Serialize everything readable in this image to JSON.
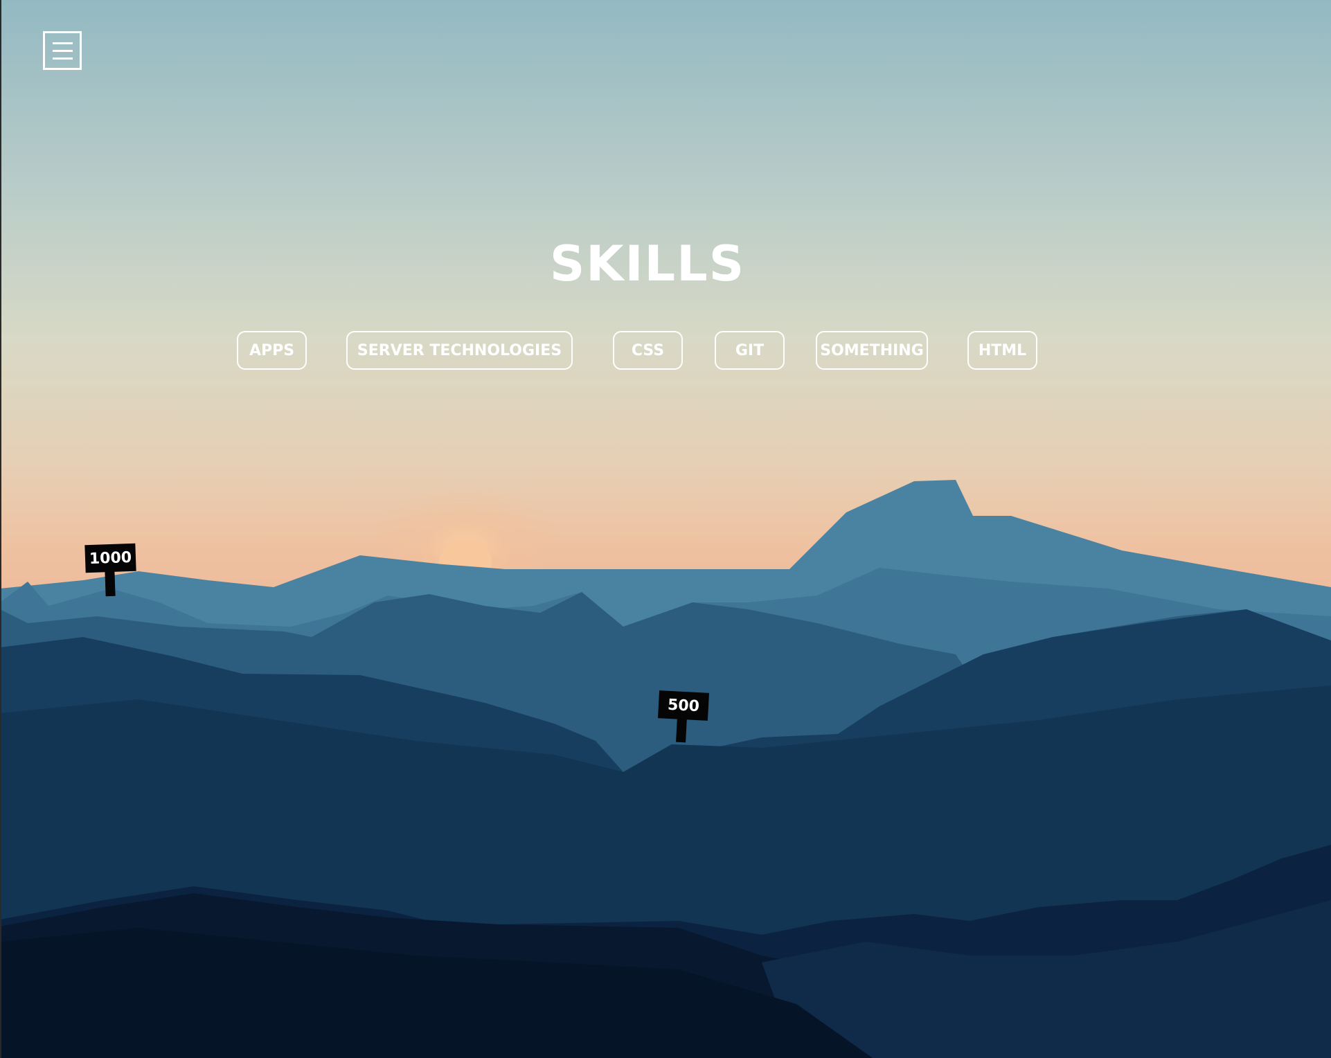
{
  "menu": {
    "icon": "hamburger-menu-icon"
  },
  "page": {
    "title": "SKILLS"
  },
  "tags": [
    {
      "label": "APPS"
    },
    {
      "label": "SERVER TECHNOLOGIES"
    },
    {
      "label": "CSS"
    },
    {
      "label": "GIT"
    },
    {
      "label": "SOMETHING"
    },
    {
      "label": "HTML"
    }
  ],
  "signs": [
    {
      "label": "1000"
    },
    {
      "label": "500"
    }
  ],
  "colors": {
    "sky_top": "#93b9c2",
    "sky_horizon": "#edc3a3",
    "sun": "#f6c79a",
    "mountain_far": "#477f9e",
    "mountain_mid": "#2f607f",
    "mountain_near": "#153a59",
    "mountain_front": "#07172d",
    "accent": "#ffffff"
  }
}
